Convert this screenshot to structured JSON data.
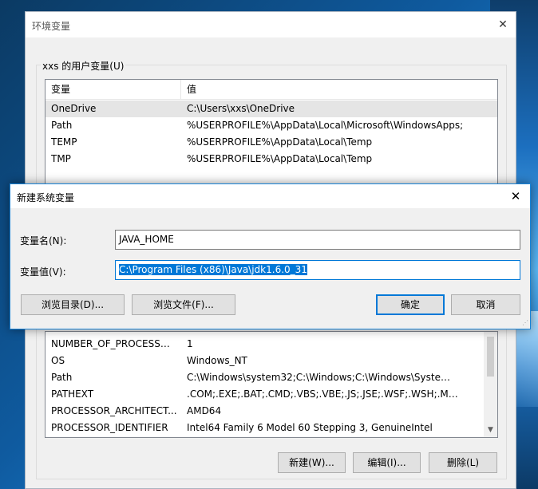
{
  "env_window": {
    "title": "环境变量",
    "user_group_label": "xxs 的用户变量(U)",
    "columns": [
      "变量",
      "值"
    ],
    "user_vars": [
      {
        "name": "OneDrive",
        "value": "C:\\Users\\xxs\\OneDrive"
      },
      {
        "name": "Path",
        "value": "%USERPROFILE%\\AppData\\Local\\Microsoft\\WindowsApps;"
      },
      {
        "name": "TEMP",
        "value": "%USERPROFILE%\\AppData\\Local\\Temp"
      },
      {
        "name": "TMP",
        "value": "%USERPROFILE%\\AppData\\Local\\Temp"
      }
    ],
    "system_vars": [
      {
        "name": "NUMBER_OF_PROCESSORS",
        "value": "1"
      },
      {
        "name": "OS",
        "value": "Windows_NT"
      },
      {
        "name": "Path",
        "value": "C:\\Windows\\system32;C:\\Windows;C:\\Windows\\System32\\Wb..."
      },
      {
        "name": "PATHEXT",
        "value": ".COM;.EXE;.BAT;.CMD;.VBS;.VBE;.JS;.JSE;.WSF;.WSH;.MSC"
      },
      {
        "name": "PROCESSOR_ARCHITECT...",
        "value": "AMD64"
      },
      {
        "name": "PROCESSOR_IDENTIFIER",
        "value": "Intel64 Family 6 Model 60 Stepping 3, GenuineIntel"
      }
    ],
    "buttons": {
      "new": "新建(W)...",
      "edit": "编辑(I)...",
      "delete": "删除(L)"
    }
  },
  "dialog": {
    "title": "新建系统变量",
    "name_label": "变量名(N):",
    "name_value": "JAVA_HOME",
    "value_label": "变量值(V):",
    "value_value": "C:\\Program Files (x86)\\Java\\jdk1.6.0_31",
    "browse_dir": "浏览目录(D)...",
    "browse_file": "浏览文件(F)...",
    "ok": "确定",
    "cancel": "取消"
  },
  "icons": {
    "close": "close-icon",
    "scroll_up": "chevron-up-icon",
    "scroll_down": "chevron-down-icon"
  },
  "colors": {
    "accent": "#0078d7",
    "selection": "#0078d7"
  }
}
